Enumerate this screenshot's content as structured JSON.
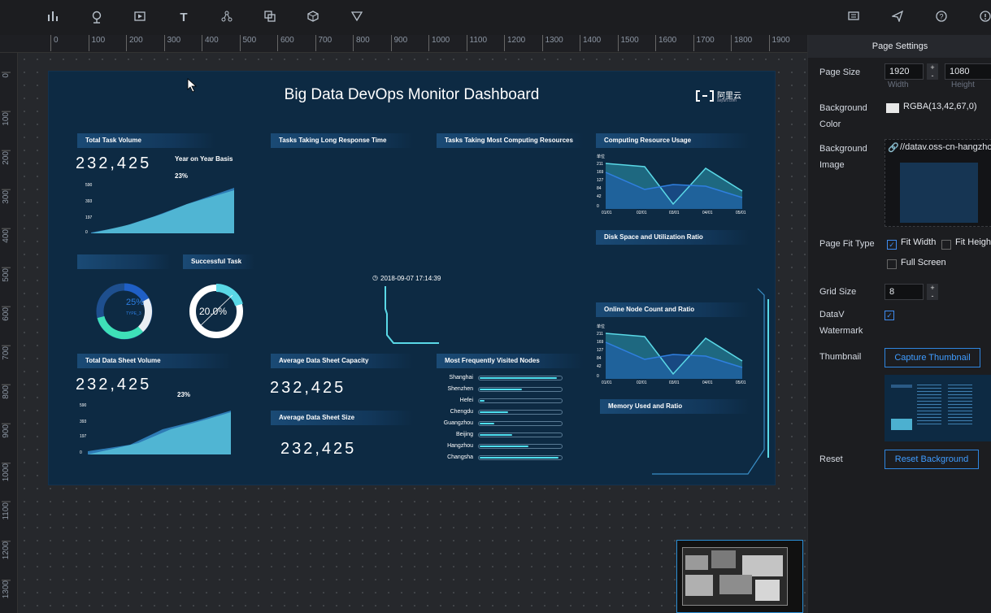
{
  "toolbar": {
    "left_icons": [
      "bar-chart-icon",
      "map-pin-icon",
      "media-icon",
      "text-icon",
      "network-icon",
      "layers-icon",
      "box-icon",
      "filter-icon"
    ],
    "right_icons": [
      "comment-icon",
      "send-icon",
      "help-icon",
      "info-icon"
    ]
  },
  "ruler": {
    "h_ticks": [
      "0",
      "100",
      "200",
      "300",
      "400",
      "500",
      "600",
      "700",
      "800",
      "900",
      "1000",
      "1100",
      "1200",
      "1300",
      "1400",
      "1500",
      "1600",
      "1700",
      "1800",
      "1900"
    ],
    "v_ticks": [
      "0",
      "100",
      "200",
      "300",
      "400",
      "500",
      "600",
      "700",
      "800",
      "900",
      "1000",
      "1100",
      "1200",
      "1300",
      "14"
    ]
  },
  "dashboard": {
    "title": "Big Data DevOps Monitor Dashboard",
    "logo_text": "阿里云",
    "logo_sub": "aliyun.com",
    "widgets": {
      "total_task_volume": "Total Task Volume",
      "long_response": "Tasks Taking Long Response Time",
      "most_computing": "Tasks Taking Most Computing Resources",
      "computing_usage": "Computing Resource Usage",
      "disk_space": "Disk Space and Utilization Ratio",
      "successful_task": "Successful Task",
      "online_node": "Online Node Count and Ratio",
      "total_data_sheet": "Total Data Sheet Volume",
      "avg_capacity": "Average Data Sheet Capacity",
      "visited_nodes": "Most Frequently Visited Nodes",
      "avg_size": "Average Data Sheet Size",
      "memory_used": "Memory Used and Ratio"
    },
    "task_volume_value": "232,425",
    "yoy_label": "Year on Year Basis",
    "yoy_value": "23%",
    "area_y_ticks": [
      "590",
      "393",
      "197",
      "0"
    ],
    "donut1_value": "25%",
    "donut1_type": "TYPE_3",
    "donut2_value": "20.0%",
    "timestamp": "2018-09-07 17:14:39",
    "data_sheet_value": "232,425",
    "data_sheet_pct": "23%",
    "avg_capacity_value": "232,425",
    "avg_size_value": "232,425",
    "line_unit": "单位",
    "line_y_ticks": [
      "211",
      "169",
      "127",
      "84",
      "42",
      "0"
    ],
    "line_x_ticks": [
      "01/01",
      "02/01",
      "03/01",
      "04/01",
      "05/01"
    ],
    "nodes": [
      {
        "name": "Shanghai",
        "pct": 0.95
      },
      {
        "name": "Shenzhen",
        "pct": 0.52
      },
      {
        "name": "Hefei",
        "pct": 0.06
      },
      {
        "name": "Chengdu",
        "pct": 0.35
      },
      {
        "name": "Guangzhou",
        "pct": 0.18
      },
      {
        "name": "Beijing",
        "pct": 0.4
      },
      {
        "name": "Hangzhou",
        "pct": 0.6
      },
      {
        "name": "Changsha",
        "pct": 0.97
      }
    ]
  },
  "panel": {
    "header": "Page Settings",
    "page_size_label": "Page Size",
    "width_value": "1920",
    "height_value": "1080",
    "width_sub": "Width",
    "height_sub": "Height",
    "bg_color_label": "Background Color",
    "bg_color_value": "RGBA(13,42,67,0)",
    "bg_image_label": "Background Image",
    "bg_image_url": "//datav.oss-cn-hangzhou.a",
    "fit_type_label": "Page Fit Type",
    "fit_width": "Fit Width",
    "fit_height": "Fit Height",
    "full_screen": "Full Screen",
    "grid_size_label": "Grid Size",
    "grid_size_value": "8",
    "watermark_label": "DataV Watermark",
    "thumbnail_label": "Thumbnail",
    "capture_btn": "Capture Thumbnail",
    "reset_label": "Reset",
    "reset_btn": "Reset Background"
  }
}
